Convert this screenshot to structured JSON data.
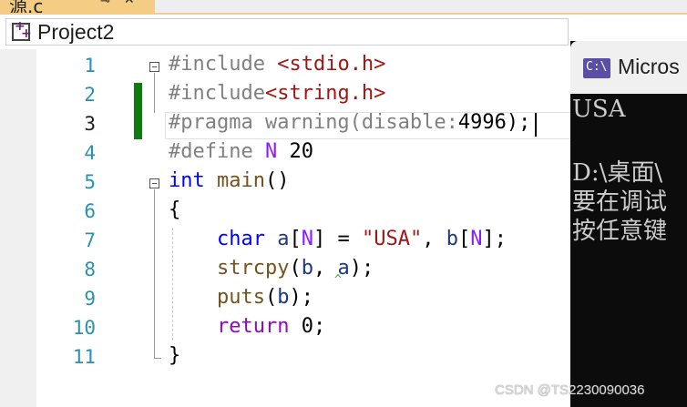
{
  "tab": {
    "title": "源.c",
    "pin": "⊸",
    "close": "✕"
  },
  "navbar": {
    "project_name": "Project2",
    "project_icon": "project-icon"
  },
  "editor": {
    "line_numbers": [
      "1",
      "2",
      "3",
      "4",
      "5",
      "6",
      "7",
      "8",
      "9",
      "10",
      "11"
    ],
    "current_line": 3
  },
  "code": {
    "l1": {
      "directive": "#include",
      "space": " ",
      "header": "<stdio.h>"
    },
    "l2": {
      "directive": "#include",
      "header": "<string.h>"
    },
    "l3": {
      "directive": "#pragma",
      "rest_a": " warning(disable:",
      "num": "4996",
      "rest_b": ");"
    },
    "l4": {
      "directive": "#define",
      "macro": "N",
      "value": "20"
    },
    "l5": {
      "type": "int",
      "name": "main",
      "parens": "()"
    },
    "l6": {
      "text": "{"
    },
    "l7": {
      "type": "char",
      "var_a": "a",
      "lb1": "[",
      "macro1": "N",
      "rb1": "]",
      "eq": " = ",
      "str": "\"USA\"",
      "comma": ", ",
      "var_b": "b",
      "lb2": "[",
      "macro2": "N",
      "rb2": "];"
    },
    "l8": {
      "fn": "strcpy",
      "open": "(",
      "arg1": "b",
      "comma": ", ",
      "arg2": "a",
      "close": ");"
    },
    "l9": {
      "fn": "puts",
      "open": "(",
      "arg": "b",
      "close": ");"
    },
    "l10": {
      "kw": "return",
      "val": " 0;"
    },
    "l11": {
      "text": "}"
    }
  },
  "console": {
    "title": "Micros",
    "icon_label": "C:\\",
    "lines": [
      "USA",
      "",
      "D:\\桌面\\",
      "要在调试",
      "按任意键"
    ]
  },
  "watermark": "CSDN @TS2230090036",
  "colors": {
    "tab_accent": "#f5cc84",
    "change_marker": "#107c10",
    "line_number": "#2b91af",
    "keyword": "#0000ff",
    "string": "#a31515",
    "console_bg": "#0c0c0c"
  }
}
